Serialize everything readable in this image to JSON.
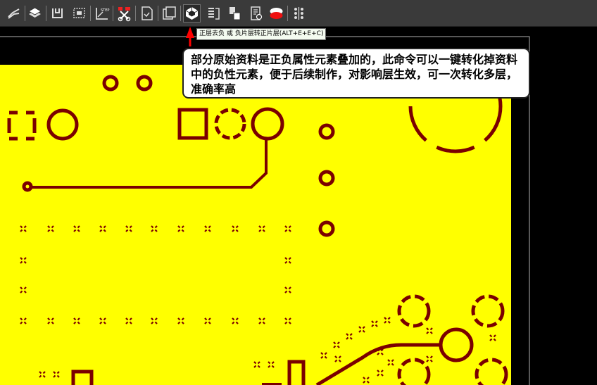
{
  "toolbar": {
    "items": [
      {
        "name": "route-icon"
      },
      {
        "name": "layers-icon"
      },
      {
        "name": "outline-icon"
      },
      {
        "name": "select-box-icon"
      },
      {
        "name": "step-icon",
        "label": "STEP"
      },
      {
        "name": "cut-icon"
      },
      {
        "name": "file-convert-icon"
      },
      {
        "name": "copy-panel-icon"
      },
      {
        "name": "negative-to-positive-icon",
        "active": true
      },
      {
        "name": "layer-list-icon"
      },
      {
        "name": "layer-merge-icon"
      },
      {
        "name": "document-check-icon"
      },
      {
        "name": "red-ellipse-icon"
      },
      {
        "name": "pins-icon"
      }
    ]
  },
  "tooltip": {
    "hint": "正层去负 或 负片层转正片层(ALT+E+E+C)",
    "callout": "部分原始资料是正负属性元素叠加的，此命令可以一键转化掉资料中的负性元素，便于后续制作，对影响层生效，可一次转化多层，准确率高"
  },
  "colors": {
    "copper": "#ffff00",
    "feature": "#7a0000",
    "background": "#000000",
    "toolbar": "#3a3a3a",
    "arrow": "#ff0000"
  }
}
